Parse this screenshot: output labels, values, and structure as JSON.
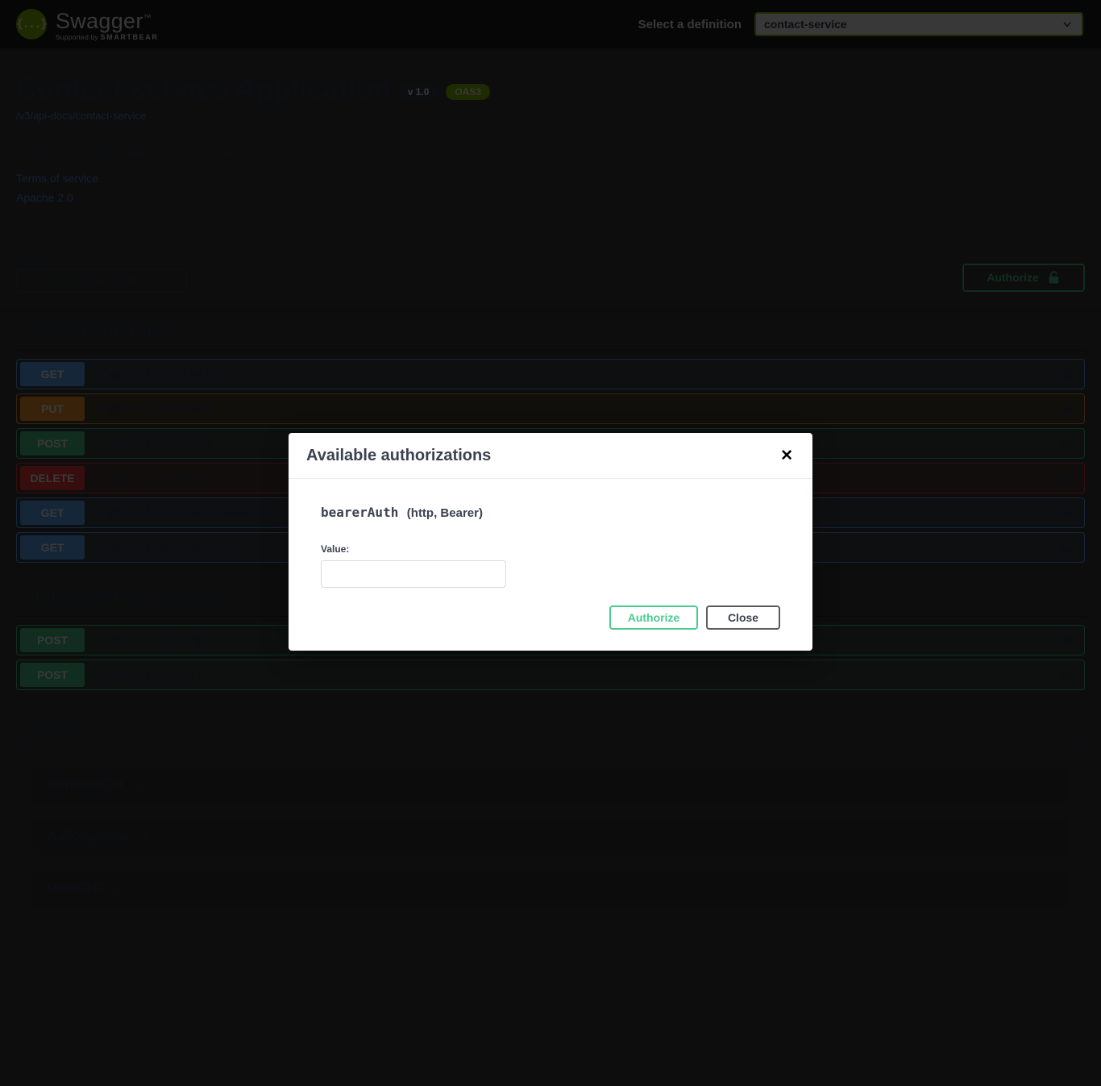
{
  "topbar": {
    "logo_text": "Swagger",
    "logo_mark": "{...}",
    "logo_supported_prefix": "Supported by",
    "logo_supported_brand": "SMARTBEAR",
    "definition_label": "Select a definition",
    "definition_value": "contact-service",
    "chevron_icon": "chevron-down-icon"
  },
  "info": {
    "title": "Contact service Application",
    "version_badge": "v 1.0",
    "oas_badge": "OAS3",
    "docs_url": "/v3/api-docs/contact-service",
    "description": "Contact service Application with JWT authentication",
    "terms_link": "Terms of service",
    "license_link": "Apache 2.0"
  },
  "servers": {
    "label": "Servers",
    "selected": "/ - Default Server URL",
    "authorize_label": "Authorize",
    "lock_icon": "unlocked-padlock-icon"
  },
  "sections": [
    {
      "name": "contact-controller",
      "collapse_icon": "chevron-up-icon",
      "operations": [
        {
          "method": "GET",
          "path": "/api/v1/contact"
        },
        {
          "method": "PUT",
          "path": "/api/v1/contact"
        },
        {
          "method": "POST",
          "path": "/api/v1/contact"
        },
        {
          "method": "DELETE",
          "path": "/api/v1/contact"
        },
        {
          "method": "GET",
          "path": "/api/v1/contact/search"
        },
        {
          "method": "GET",
          "path": "/api/v1/allContact"
        }
      ]
    },
    {
      "name": "authentication-controller",
      "collapse_icon": "chevron-up-icon",
      "operations": [
        {
          "method": "POST",
          "path": "/api/v1/signUp"
        },
        {
          "method": "POST",
          "path": "/api/v1/signIn"
        }
      ]
    }
  ],
  "schemas": {
    "title": "Schemas",
    "collapse_icon": "chevron-up-icon",
    "items": [
      {
        "name": "ContactDTO"
      },
      {
        "name": "ApiResponse"
      },
      {
        "name": "UserDTO"
      }
    ]
  },
  "modal": {
    "title": "Available authorizations",
    "close_icon": "close-icon",
    "scheme_name": "bearerAuth",
    "scheme_type": "(http, Bearer)",
    "value_label": "Value:",
    "value": "",
    "value_placeholder": "",
    "authorize_label": "Authorize",
    "close_label": "Close"
  },
  "colors": {
    "brand_green": "#89bf04",
    "accent_green": "#49cc90",
    "get": "#61affe",
    "put": "#fca130",
    "post": "#49cc90",
    "delete": "#f93e3e",
    "text": "#3b4151",
    "link": "#4a90e2"
  }
}
